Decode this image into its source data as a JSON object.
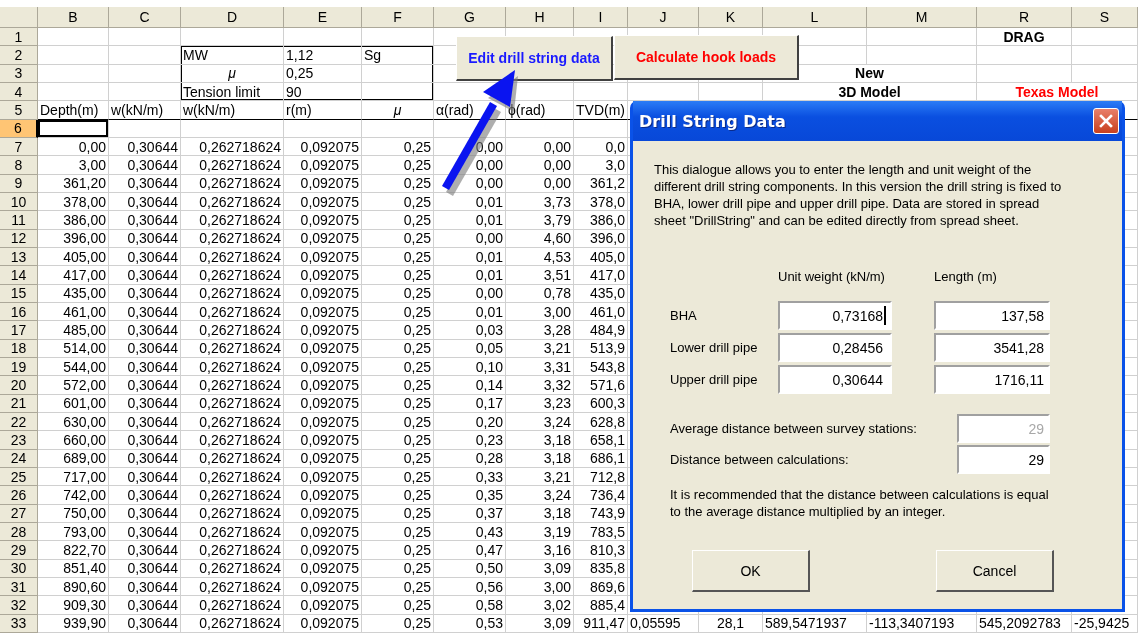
{
  "sheet": {
    "columns": [
      "B",
      "C",
      "D",
      "E",
      "F",
      "G",
      "H",
      "I",
      "J",
      "K",
      "L",
      "M",
      "R",
      "S"
    ],
    "rows": [
      {
        "header": "1",
        "selected": false,
        "kind": "blank",
        "cells": [
          null,
          null,
          null,
          null,
          null,
          null,
          null,
          null,
          null,
          null,
          null,
          null,
          {
            "text": "DRAG",
            "kind": "caption"
          }
        ]
      },
      {
        "header": "2",
        "selected": false,
        "kind": "blank",
        "cells": [
          null,
          null,
          {
            "text": "MW",
            "kind": "label"
          },
          {
            "text": "1,12",
            "kind": "label"
          },
          {
            "text": "Sg",
            "kind": "label"
          }
        ]
      },
      {
        "header": "3",
        "selected": false,
        "kind": "blank",
        "cells": [
          null,
          null,
          {
            "text": "μ",
            "kind": "symbol"
          },
          {
            "text": "0,25",
            "kind": "label"
          },
          null,
          null,
          null,
          null,
          null,
          null,
          {
            "text": "New",
            "kind": "title"
          }
        ]
      },
      {
        "header": "4",
        "selected": false,
        "kind": "blank",
        "cells": [
          null,
          null,
          {
            "text": "Tension limit",
            "kind": "label"
          },
          {
            "text": "90",
            "kind": "label"
          },
          null,
          null,
          null,
          null,
          null,
          null,
          {
            "text": "3D Model",
            "kind": "title"
          },
          null,
          {
            "text": "Texas Model",
            "kind": "alert"
          }
        ]
      },
      {
        "header": "5",
        "selected": false,
        "kind": "heading",
        "cells": [
          {
            "text": "Depth(m)",
            "kind": "label"
          },
          {
            "text": "w(kN/m)",
            "kind": "label"
          },
          {
            "text": "w(kN/m)",
            "kind": "label"
          },
          {
            "text": "r(m)",
            "kind": "label"
          },
          {
            "text": "μ",
            "kind": "symbol"
          },
          {
            "text": "α(rad)",
            "kind": "label"
          },
          {
            "text": "ϕ(rad)",
            "kind": "label"
          },
          {
            "text": "TVD(m)",
            "kind": "label"
          }
        ]
      },
      {
        "header": "6",
        "selected": true,
        "kind": "blank",
        "cells": []
      },
      {
        "header": "7",
        "selected": false,
        "kind": "data",
        "cells": [
          "0,00",
          "0,30644",
          "0,262718624",
          "0,092075",
          "0,25",
          "0,00",
          "0,00",
          "0,0"
        ]
      },
      {
        "header": "8",
        "selected": false,
        "kind": "data",
        "cells": [
          "3,00",
          "0,30644",
          "0,262718624",
          "0,092075",
          "0,25",
          "0,00",
          "0,00",
          "3,0"
        ]
      },
      {
        "header": "9",
        "selected": false,
        "kind": "data",
        "cells": [
          "361,20",
          "0,30644",
          "0,262718624",
          "0,092075",
          "0,25",
          "0,00",
          "0,00",
          "361,2"
        ]
      },
      {
        "header": "10",
        "selected": false,
        "kind": "data",
        "cells": [
          "378,00",
          "0,30644",
          "0,262718624",
          "0,092075",
          "0,25",
          "0,01",
          "3,73",
          "378,0"
        ]
      },
      {
        "header": "11",
        "selected": false,
        "kind": "data",
        "cells": [
          "386,00",
          "0,30644",
          "0,262718624",
          "0,092075",
          "0,25",
          "0,01",
          "3,79",
          "386,0"
        ]
      },
      {
        "header": "12",
        "selected": false,
        "kind": "data",
        "cells": [
          "396,00",
          "0,30644",
          "0,262718624",
          "0,092075",
          "0,25",
          "0,00",
          "4,60",
          "396,0"
        ]
      },
      {
        "header": "13",
        "selected": false,
        "kind": "data",
        "cells": [
          "405,00",
          "0,30644",
          "0,262718624",
          "0,092075",
          "0,25",
          "0,01",
          "4,53",
          "405,0"
        ]
      },
      {
        "header": "14",
        "selected": false,
        "kind": "data",
        "cells": [
          "417,00",
          "0,30644",
          "0,262718624",
          "0,092075",
          "0,25",
          "0,01",
          "3,51",
          "417,0"
        ]
      },
      {
        "header": "15",
        "selected": false,
        "kind": "data",
        "cells": [
          "435,00",
          "0,30644",
          "0,262718624",
          "0,092075",
          "0,25",
          "0,00",
          "0,78",
          "435,0"
        ]
      },
      {
        "header": "16",
        "selected": false,
        "kind": "data",
        "cells": [
          "461,00",
          "0,30644",
          "0,262718624",
          "0,092075",
          "0,25",
          "0,01",
          "3,00",
          "461,0"
        ]
      },
      {
        "header": "17",
        "selected": false,
        "kind": "data",
        "cells": [
          "485,00",
          "0,30644",
          "0,262718624",
          "0,092075",
          "0,25",
          "0,03",
          "3,28",
          "484,9"
        ]
      },
      {
        "header": "18",
        "selected": false,
        "kind": "data",
        "cells": [
          "514,00",
          "0,30644",
          "0,262718624",
          "0,092075",
          "0,25",
          "0,05",
          "3,21",
          "513,9"
        ]
      },
      {
        "header": "19",
        "selected": false,
        "kind": "data",
        "cells": [
          "544,00",
          "0,30644",
          "0,262718624",
          "0,092075",
          "0,25",
          "0,10",
          "3,31",
          "543,8"
        ]
      },
      {
        "header": "20",
        "selected": false,
        "kind": "data",
        "cells": [
          "572,00",
          "0,30644",
          "0,262718624",
          "0,092075",
          "0,25",
          "0,14",
          "3,32",
          "571,6"
        ]
      },
      {
        "header": "21",
        "selected": false,
        "kind": "data",
        "cells": [
          "601,00",
          "0,30644",
          "0,262718624",
          "0,092075",
          "0,25",
          "0,17",
          "3,23",
          "600,3"
        ]
      },
      {
        "header": "22",
        "selected": false,
        "kind": "data",
        "cells": [
          "630,00",
          "0,30644",
          "0,262718624",
          "0,092075",
          "0,25",
          "0,20",
          "3,24",
          "628,8"
        ]
      },
      {
        "header": "23",
        "selected": false,
        "kind": "data",
        "cells": [
          "660,00",
          "0,30644",
          "0,262718624",
          "0,092075",
          "0,25",
          "0,23",
          "3,18",
          "658,1"
        ]
      },
      {
        "header": "24",
        "selected": false,
        "kind": "data",
        "cells": [
          "689,00",
          "0,30644",
          "0,262718624",
          "0,092075",
          "0,25",
          "0,28",
          "3,18",
          "686,1"
        ]
      },
      {
        "header": "25",
        "selected": false,
        "kind": "data",
        "cells": [
          "717,00",
          "0,30644",
          "0,262718624",
          "0,092075",
          "0,25",
          "0,33",
          "3,21",
          "712,8"
        ]
      },
      {
        "header": "26",
        "selected": false,
        "kind": "data",
        "cells": [
          "742,00",
          "0,30644",
          "0,262718624",
          "0,092075",
          "0,25",
          "0,35",
          "3,24",
          "736,4"
        ]
      },
      {
        "header": "27",
        "selected": false,
        "kind": "data",
        "cells": [
          "750,00",
          "0,30644",
          "0,262718624",
          "0,092075",
          "0,25",
          "0,37",
          "3,18",
          "743,9"
        ]
      },
      {
        "header": "28",
        "selected": false,
        "kind": "data",
        "cells": [
          "793,00",
          "0,30644",
          "0,262718624",
          "0,092075",
          "0,25",
          "0,43",
          "3,19",
          "783,5"
        ]
      },
      {
        "header": "29",
        "selected": false,
        "kind": "data",
        "cells": [
          "822,70",
          "0,30644",
          "0,262718624",
          "0,092075",
          "0,25",
          "0,47",
          "3,16",
          "810,3"
        ]
      },
      {
        "header": "30",
        "selected": false,
        "kind": "data",
        "cells": [
          "851,40",
          "0,30644",
          "0,262718624",
          "0,092075",
          "0,25",
          "0,50",
          "3,09",
          "835,8"
        ]
      },
      {
        "header": "31",
        "selected": false,
        "kind": "data",
        "cells": [
          "890,60",
          "0,30644",
          "0,262718624",
          "0,092075",
          "0,25",
          "0,56",
          "3,00",
          "869,6"
        ]
      },
      {
        "header": "32",
        "selected": false,
        "kind": "data",
        "cells": [
          "909,30",
          "0,30644",
          "0,262718624",
          "0,092075",
          "0,25",
          "0,58",
          "3,02",
          "885,4"
        ]
      },
      {
        "header": "33",
        "selected": false,
        "kind": "data",
        "cells": [
          "939,90",
          "0,30644",
          "0,262718624",
          "0,092075",
          "0,25",
          "0,53",
          "3,09",
          "911,47",
          {
            "text": "0,05595",
            "kind": "label"
          },
          {
            "text": "28,1",
            "kind": "centered"
          },
          {
            "text": "589,5471937",
            "kind": "label"
          },
          {
            "text": "-113,3407193",
            "kind": "label"
          },
          {
            "text": "545,2092783",
            "kind": "label"
          },
          {
            "text": "-25,9425",
            "kind": "label"
          }
        ]
      }
    ]
  },
  "sheet_buttons": [
    {
      "label": "Edit drill string data",
      "kind": "edit"
    },
    {
      "label": "Calculate hook loads",
      "kind": "calculate"
    }
  ],
  "dialog": {
    "title": "Drill String Data",
    "description": "This dialogue allows you to enter the length and unit weight of the different drill string components. In this version the drill string is fixed to BHA, lower drill pipe and upper drill pipe. Data are stored in spread sheet \"DrillString\" and can be edited directly from spread sheet.",
    "column_headers": [
      "Unit weight (kN/m)",
      "Length (m)"
    ],
    "components": [
      {
        "label": "BHA",
        "unit_weight": "0,73168",
        "unit_weight_focused": true,
        "length": "137,58"
      },
      {
        "label": "Lower drill pipe",
        "unit_weight": "0,28456",
        "unit_weight_focused": false,
        "length": "3541,28"
      },
      {
        "label": "Upper drill pipe",
        "unit_weight": "0,30644",
        "unit_weight_focused": false,
        "length": "1716,11"
      }
    ],
    "distances": [
      {
        "label": "Average distance between survey stations:",
        "value": "29",
        "disabled": true
      },
      {
        "label": "Distance between calculations:",
        "value": "29",
        "disabled": false
      }
    ],
    "note": "It is recommended that the distance between calculations is equal to the average distance multiplied by an integer.",
    "buttons": [
      "OK",
      "Cancel"
    ]
  }
}
